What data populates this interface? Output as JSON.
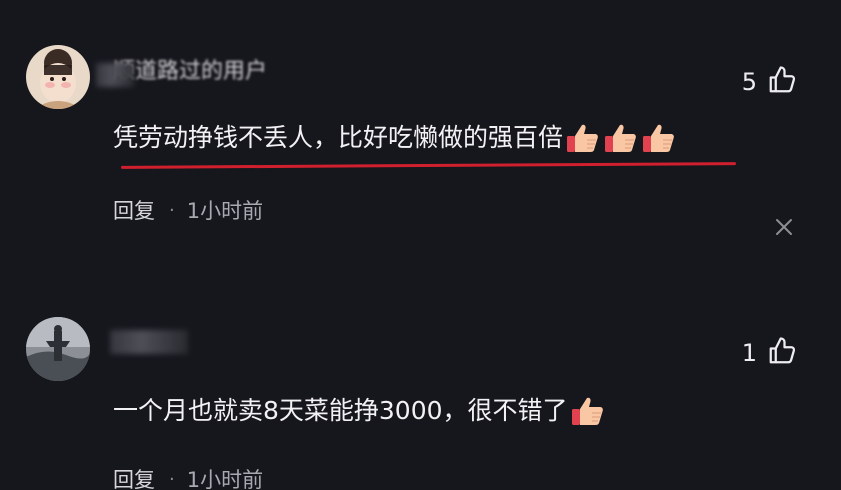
{
  "comments": [
    {
      "username": "顺道路过的用户",
      "text": "凭劳动挣钱不丢人，比好吃懒做的强百倍",
      "emoji_count": 3,
      "emoji": "thumbs-up-icon",
      "likes": "5",
      "reply_label": "回复",
      "separator": "·",
      "time": "1小时前",
      "highlight_color": "#d0202e"
    },
    {
      "username": "",
      "text": "一个月也就卖8天菜能挣3000，很不错了",
      "emoji_count": 1,
      "emoji": "thumbs-up-icon",
      "likes": "1",
      "reply_label": "回复",
      "separator": "·",
      "time": "1小时前"
    }
  ],
  "colors": {
    "background": "#16161d",
    "text": "#f2f2f5",
    "muted": "#a9a9b1",
    "accent_underline": "#d0202e"
  }
}
